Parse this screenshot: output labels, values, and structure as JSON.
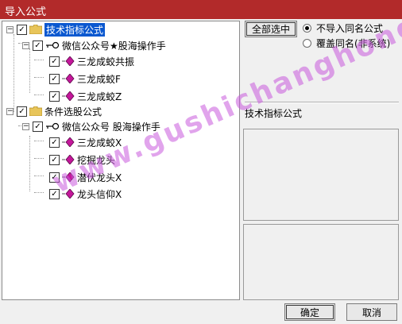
{
  "window": {
    "title": "导入公式"
  },
  "tree": {
    "groups": [
      {
        "label": "技术指标公式",
        "author": "微信公众号★股海操作手",
        "items": [
          "三龙成蛟共振",
          "三龙成蛟F",
          "三龙成蛟Z"
        ]
      },
      {
        "label": "条件选股公式",
        "author": "微信公众号 股海操作手",
        "items": [
          "三龙成蛟X",
          "挖掘龙头",
          "潜伏龙头X",
          "龙头信仰X"
        ]
      }
    ]
  },
  "right": {
    "select_all_label": "全部选中",
    "radio_options": [
      "不导入同名公式",
      "覆盖同名(非系统)"
    ],
    "selected_radio": 0,
    "info_title": "技术指标公式"
  },
  "footer": {
    "ok_label": "确定",
    "cancel_label": "取消"
  },
  "watermark": "www.gushichanghong.com",
  "colors": {
    "titlebar": "#b22a2a",
    "selection": "#0a58d0",
    "gem": "#c4179a"
  }
}
